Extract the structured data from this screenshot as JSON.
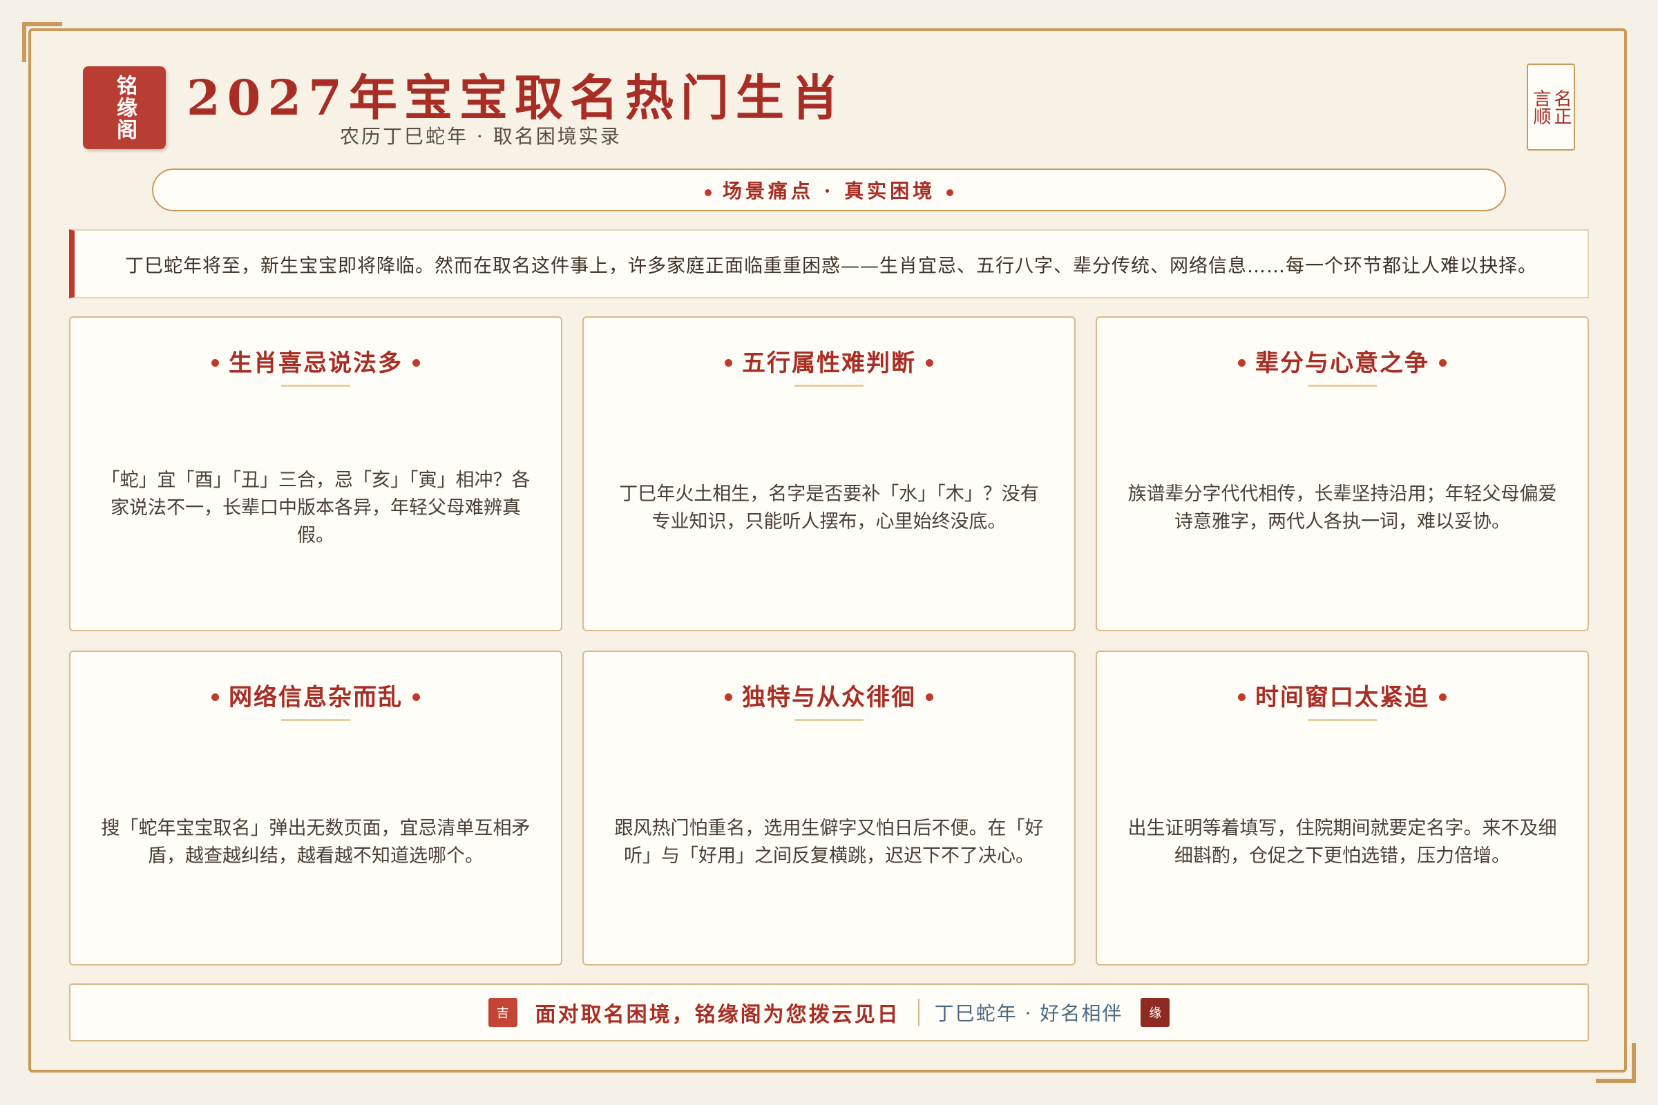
{
  "header": {
    "seal": "铭缘阁",
    "title": "2027年宝宝取名热门生肖",
    "subtitle": "农历丁巳蛇年 · 取名困境实录",
    "tag_right": "名正",
    "tag_left": "言顺"
  },
  "banner": {
    "label": "场景痛点 · 真实困境"
  },
  "intro": {
    "text": "丁巳蛇年将至，新生宝宝即将降临。然而在取名这件事上，许多家庭正面临重重困惑——生肖宜忌、五行八字、辈分传统、网络信息……每一个环节都让人难以抉择。"
  },
  "cards": [
    {
      "title": "生肖喜忌说法多",
      "body": "「蛇」宜「酉」「丑」三合，忌「亥」「寅」相冲？各家说法不一，长辈口中版本各异，年轻父母难辨真假。"
    },
    {
      "title": "五行属性难判断",
      "body": "丁巳年火土相生，名字是否要补「水」「木」？没有专业知识，只能听人摆布，心里始终没底。"
    },
    {
      "title": "辈分与心意之争",
      "body": "族谱辈分字代代相传，长辈坚持沿用；年轻父母偏爱诗意雅字，两代人各执一词，难以妥协。"
    },
    {
      "title": "网络信息杂而乱",
      "body": "搜「蛇年宝宝取名」弹出无数页面，宜忌清单互相矛盾，越查越纠结，越看越不知道选哪个。"
    },
    {
      "title": "独特与从众徘徊",
      "body": "跟风热门怕重名，选用生僻字又怕日后不便。在「好听」与「好用」之间反复横跳，迟迟下不了决心。"
    },
    {
      "title": "时间窗口太紧迫",
      "body": "出生证明等着填写，住院期间就要定名字。来不及细细斟酌，仓促之下更怕选错，压力倍增。"
    }
  ],
  "footer": {
    "stamp_left": "吉",
    "main": "面对取名困境，铭缘阁为您拨云见日",
    "sub": "丁巳蛇年 · 好名相伴",
    "stamp_right": "缘"
  }
}
